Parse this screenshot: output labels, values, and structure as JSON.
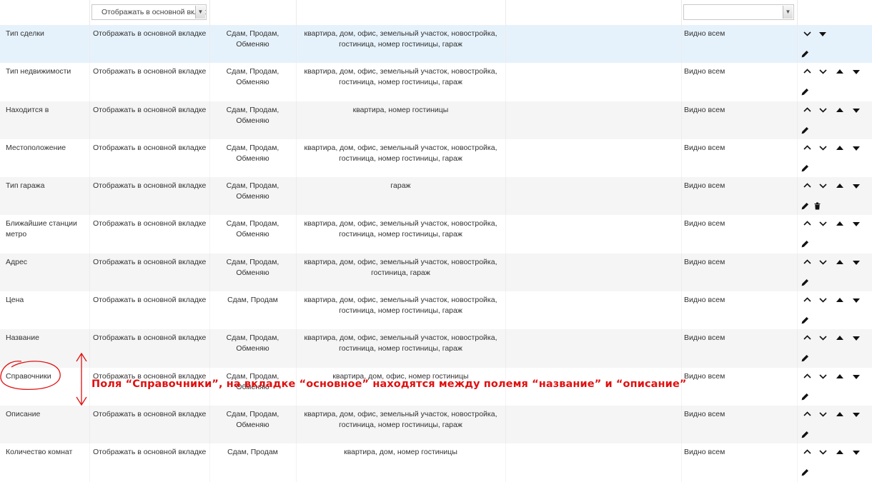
{
  "filters": {
    "tab_select_value": "Отображать в основной вкладке",
    "visibility_select_value": ""
  },
  "rows": [
    {
      "name": "Тип сделки",
      "tab": "Отображать в основной вкладке",
      "deal": "Сдам, Продам, Обменяю",
      "types": "квартира, дом, офис, земельный участок, новостройка, гостиница, номер гостиницы, гараж",
      "visibility": "Видно всем",
      "actions": [
        "down",
        "move-down"
      ],
      "delete": false
    },
    {
      "name": "Тип недвижимости",
      "tab": "Отображать в основной вкладке",
      "deal": "Сдам, Продам, Обменяю",
      "types": "квартира, дом, офис, земельный участок, новостройка, гостиница, номер гостиницы, гараж",
      "visibility": "Видно всем",
      "actions": [
        "up",
        "down",
        "move-up",
        "move-down"
      ],
      "delete": false
    },
    {
      "name": "Находится в",
      "tab": "Отображать в основной вкладке",
      "deal": "Сдам, Продам, Обменяю",
      "types": "квартира, номер гостиницы",
      "visibility": "Видно всем",
      "actions": [
        "up",
        "down",
        "move-up",
        "move-down"
      ],
      "delete": false
    },
    {
      "name": "Местоположение",
      "tab": "Отображать в основной вкладке",
      "deal": "Сдам, Продам, Обменяю",
      "types": "квартира, дом, офис, земельный участок, новостройка, гостиница, номер гостиницы, гараж",
      "visibility": "Видно всем",
      "actions": [
        "up",
        "down",
        "move-up",
        "move-down"
      ],
      "delete": false
    },
    {
      "name": "Тип гаража",
      "tab": "Отображать в основной вкладке",
      "deal": "Сдам, Продам, Обменяю",
      "types": "гараж",
      "visibility": "Видно всем",
      "actions": [
        "up",
        "down",
        "move-up",
        "move-down"
      ],
      "delete": true
    },
    {
      "name": "Ближайшие станции метро",
      "tab": "Отображать в основной вкладке",
      "deal": "Сдам, Продам, Обменяю",
      "types": "квартира, дом, офис, земельный участок, новостройка, гостиница, номер гостиницы, гараж",
      "visibility": "Видно всем",
      "actions": [
        "up",
        "down",
        "move-up",
        "move-down"
      ],
      "delete": false
    },
    {
      "name": "Адрес",
      "tab": "Отображать в основной вкладке",
      "deal": "Сдам, Продам, Обменяю",
      "types": "квартира, дом, офис, земельный участок, новостройка, гостиница, гараж",
      "visibility": "Видно всем",
      "actions": [
        "up",
        "down",
        "move-up",
        "move-down"
      ],
      "delete": false
    },
    {
      "name": "Цена",
      "tab": "Отображать в основной вкладке",
      "deal": "Сдам, Продам",
      "types": "квартира, дом, офис, земельный участок, новостройка, гостиница, номер гостиницы, гараж",
      "visibility": "Видно всем",
      "actions": [
        "up",
        "down",
        "move-up",
        "move-down"
      ],
      "delete": false
    },
    {
      "name": "Название",
      "tab": "Отображать в основной вкладке",
      "deal": "Сдам, Продам, Обменяю",
      "types": "квартира, дом, офис, земельный участок, новостройка, гостиница, номер гостиницы, гараж",
      "visibility": "Видно всем",
      "actions": [
        "up",
        "down",
        "move-up",
        "move-down"
      ],
      "delete": false
    },
    {
      "name": "Справочники",
      "tab": "Отображать в основной вкладке",
      "deal": "Сдам, Продам, Обменяю",
      "types": "квартира, дом, офис, номер гостиницы",
      "visibility": "Видно всем",
      "actions": [
        "up",
        "down",
        "move-up",
        "move-down"
      ],
      "delete": false
    },
    {
      "name": "Описание",
      "tab": "Отображать в основной вкладке",
      "deal": "Сдам, Продам, Обменяю",
      "types": "квартира, дом, офис, земельный участок, новостройка, гостиница, номер гостиницы, гараж",
      "visibility": "Видно всем",
      "actions": [
        "up",
        "down",
        "move-up",
        "move-down"
      ],
      "delete": false
    },
    {
      "name": "Количество комнат",
      "tab": "Отображать в основной вкладке",
      "deal": "Сдам, Продам",
      "types": "квартира, дом, номер гостиницы",
      "visibility": "Видно всем",
      "actions": [
        "up",
        "down",
        "move-up",
        "move-down"
      ],
      "delete": false
    }
  ],
  "annotation": {
    "text": "Поля “Справочники”, на вкладке “основное” находятся между полемя “название” и “описание”",
    "color": "#e01111"
  },
  "colors": {
    "selected_row": "#e6f2fb",
    "odd_row": "#f5f5f5"
  }
}
